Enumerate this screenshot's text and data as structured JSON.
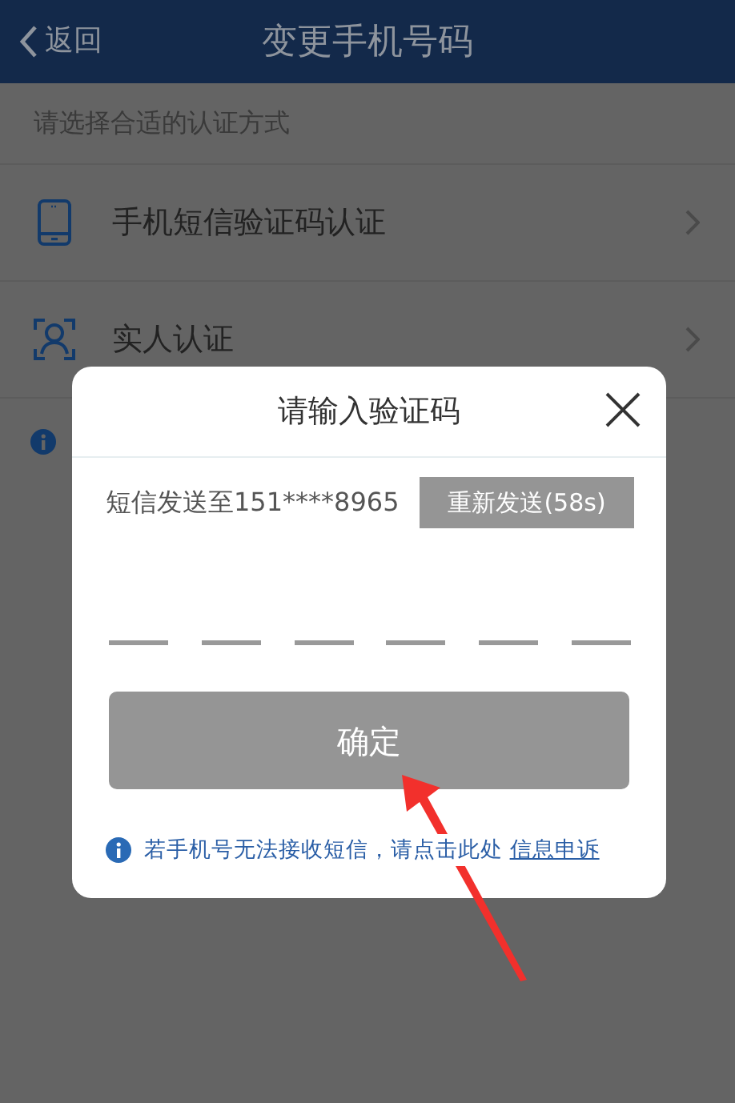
{
  "header": {
    "back_label": "返回",
    "title": "变更手机号码"
  },
  "prompt": "请选择合适的认证方式",
  "methods": [
    {
      "kind": "phone",
      "label": "手机短信验证码认证"
    },
    {
      "kind": "face",
      "label": "实人认证"
    }
  ],
  "dialog": {
    "title": "请输入验证码",
    "sent_text": "短信发送至151****8965",
    "resend_label": "重新发送(58s)",
    "resend_disabled": true,
    "code_slots": [
      {
        "filled": false
      },
      {
        "filled": false
      },
      {
        "filled": false
      },
      {
        "filled": false
      },
      {
        "filled": false
      },
      {
        "filled": false
      }
    ],
    "confirm_label": "确定",
    "confirm_disabled": true,
    "help_text": "若手机号无法接收短信，请点击此处",
    "help_link": "信息申诉"
  }
}
